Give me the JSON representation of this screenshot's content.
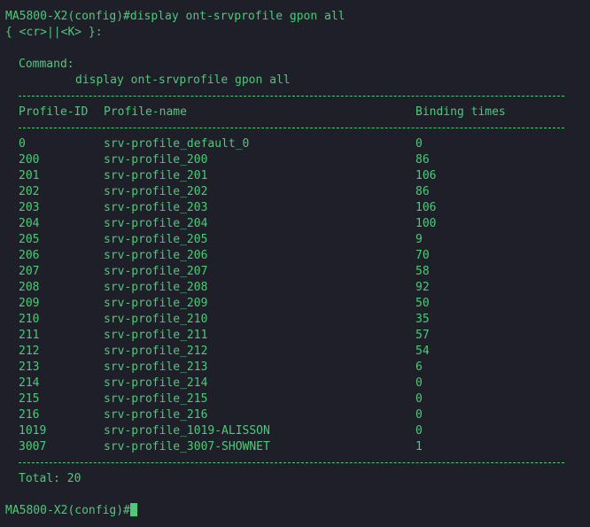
{
  "terminal": {
    "prompt_command": "MA5800-X2(config)#display ont-srvprofile gpon all",
    "hint": "{ <cr>||<K> }:",
    "command_label": "Command:",
    "command_echo": "display ont-srvprofile gpon all",
    "headers": {
      "id": "Profile-ID",
      "name": "Profile-name",
      "binding": "Binding times"
    },
    "rows": [
      {
        "id": "0",
        "name": "srv-profile_default_0",
        "binding": "0"
      },
      {
        "id": "200",
        "name": "srv-profile_200",
        "binding": "86"
      },
      {
        "id": "201",
        "name": "srv-profile_201",
        "binding": "106"
      },
      {
        "id": "202",
        "name": "srv-profile_202",
        "binding": "86"
      },
      {
        "id": "203",
        "name": "srv-profile_203",
        "binding": "106"
      },
      {
        "id": "204",
        "name": "srv-profile_204",
        "binding": "100"
      },
      {
        "id": "205",
        "name": "srv-profile_205",
        "binding": "9"
      },
      {
        "id": "206",
        "name": "srv-profile_206",
        "binding": "70"
      },
      {
        "id": "207",
        "name": "srv-profile_207",
        "binding": "58"
      },
      {
        "id": "208",
        "name": "srv-profile_208",
        "binding": "92"
      },
      {
        "id": "209",
        "name": "srv-profile_209",
        "binding": "50"
      },
      {
        "id": "210",
        "name": "srv-profile_210",
        "binding": "35"
      },
      {
        "id": "211",
        "name": "srv-profile_211",
        "binding": "57"
      },
      {
        "id": "212",
        "name": "srv-profile_212",
        "binding": "54"
      },
      {
        "id": "213",
        "name": "srv-profile_213",
        "binding": "6"
      },
      {
        "id": "214",
        "name": "srv-profile_214",
        "binding": "0"
      },
      {
        "id": "215",
        "name": "srv-profile_215",
        "binding": "0"
      },
      {
        "id": "216",
        "name": "srv-profile_216",
        "binding": "0"
      },
      {
        "id": "1019",
        "name": "srv-profile_1019-ALISSON",
        "binding": "0"
      },
      {
        "id": "3007",
        "name": "srv-profile_3007-SHOWNET",
        "binding": "1"
      }
    ],
    "total": "Total: 20",
    "final_prompt": "MA5800-X2(config)#"
  },
  "colors": {
    "background": "#1e1f29",
    "text": "#4ec97a"
  }
}
